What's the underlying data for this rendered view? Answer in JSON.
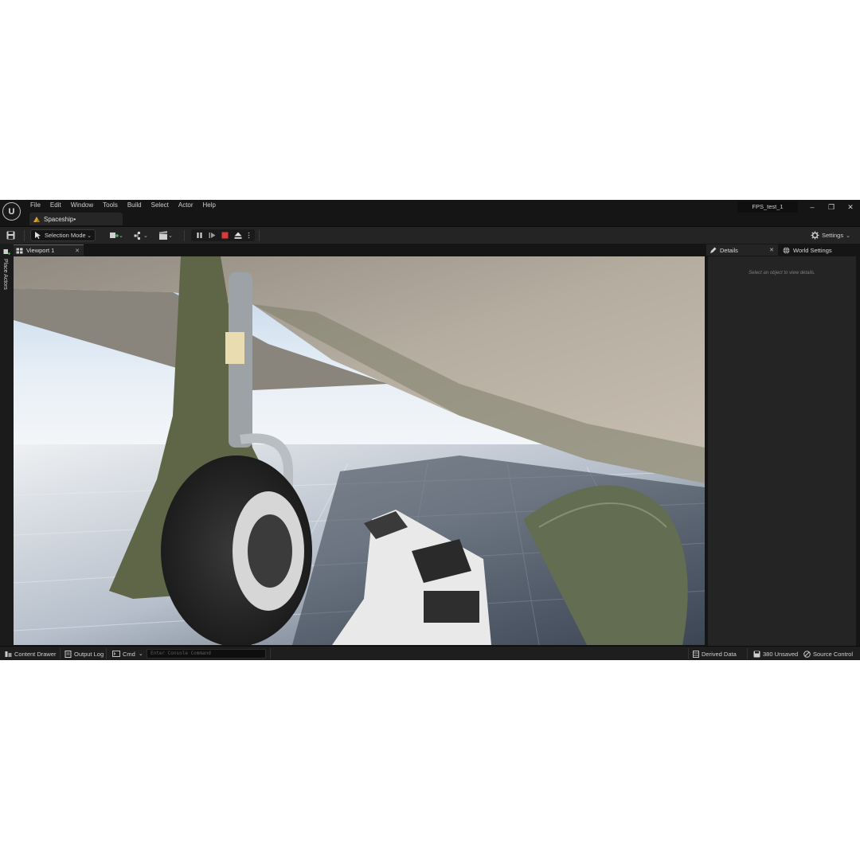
{
  "menu": [
    "File",
    "Edit",
    "Window",
    "Tools",
    "Build",
    "Select",
    "Actor",
    "Help"
  ],
  "doc_tab": {
    "label": "Spaceship•"
  },
  "project_name": "FPS_test_1",
  "toolbar": {
    "mode_label": "Selection Mode",
    "settings_label": "Settings"
  },
  "left_strip": {
    "label": "Place Actors"
  },
  "viewport": {
    "tab_label": "Viewport 1"
  },
  "details": {
    "tab_label": "Details",
    "world_tab_label": "World Settings",
    "empty_hint": "Select an object to view details."
  },
  "statusbar": {
    "content_drawer": "Content Drawer",
    "output_log": "Output Log",
    "cmd": "Cmd",
    "console_placeholder": "Enter Console Command",
    "derived_data": "Derived Data",
    "unsaved": "380 Unsaved",
    "source_control": "Source Control"
  },
  "colors": {
    "accent": "#2a6ad8",
    "stop": "#d63a3a",
    "panel": "#242424",
    "bg": "#151515"
  }
}
